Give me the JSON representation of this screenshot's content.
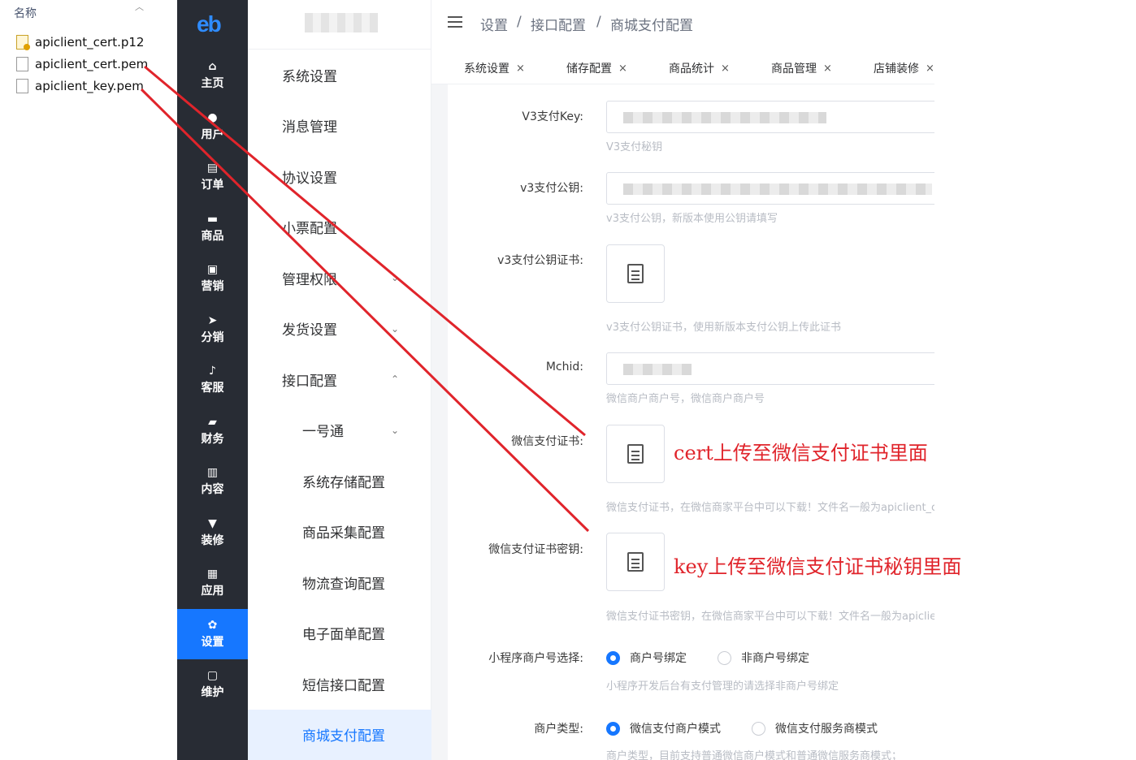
{
  "files": {
    "header": "名称",
    "items": [
      {
        "name": "apiclient_cert.p12",
        "type": "cert"
      },
      {
        "name": "apiclient_cert.pem",
        "type": "doc"
      },
      {
        "name": "apiclient_key.pem",
        "type": "doc"
      }
    ]
  },
  "nav": {
    "logo": "eb",
    "items": [
      {
        "label": "主页",
        "icon": "home-icon",
        "glyph": "⌂"
      },
      {
        "label": "用户",
        "icon": "user-icon",
        "glyph": "●"
      },
      {
        "label": "订单",
        "icon": "order-icon",
        "glyph": "▤"
      },
      {
        "label": "商品",
        "icon": "goods-icon",
        "glyph": "▬"
      },
      {
        "label": "营销",
        "icon": "chart-icon",
        "glyph": "▣"
      },
      {
        "label": "分销",
        "icon": "send-icon",
        "glyph": "➤"
      },
      {
        "label": "客服",
        "icon": "bell-icon",
        "glyph": "♪"
      },
      {
        "label": "财务",
        "icon": "wallet-icon",
        "glyph": "▰"
      },
      {
        "label": "内容",
        "icon": "book-icon",
        "glyph": "▥"
      },
      {
        "label": "装修",
        "icon": "brush-icon",
        "glyph": "▼"
      },
      {
        "label": "应用",
        "icon": "apps-icon",
        "glyph": "▦"
      },
      {
        "label": "设置",
        "icon": "gear-icon",
        "glyph": "✿",
        "active": true
      },
      {
        "label": "维护",
        "icon": "chip-icon",
        "glyph": "▢"
      }
    ]
  },
  "submenu": {
    "items": [
      {
        "label": "系统设置",
        "child": false,
        "chevron": ""
      },
      {
        "label": "消息管理",
        "child": false,
        "chevron": ""
      },
      {
        "label": "协议设置",
        "child": false,
        "chevron": ""
      },
      {
        "label": "小票配置",
        "child": false,
        "chevron": ""
      },
      {
        "label": "管理权限",
        "child": false,
        "chevron": "⌄"
      },
      {
        "label": "发货设置",
        "child": false,
        "chevron": "⌄"
      },
      {
        "label": "接口配置",
        "child": false,
        "chevron": "⌃"
      },
      {
        "label": "一号通",
        "child": true,
        "chevron": "⌄"
      },
      {
        "label": "系统存储配置",
        "child": true,
        "chevron": ""
      },
      {
        "label": "商品采集配置",
        "child": true,
        "chevron": ""
      },
      {
        "label": "物流查询配置",
        "child": true,
        "chevron": ""
      },
      {
        "label": "电子面单配置",
        "child": true,
        "chevron": ""
      },
      {
        "label": "短信接口配置",
        "child": true,
        "chevron": ""
      },
      {
        "label": "商城支付配置",
        "child": true,
        "chevron": "",
        "active": true
      }
    ]
  },
  "breadcrumb": {
    "items": [
      "设置",
      "/",
      "接口配置",
      "/",
      "商城支付配置"
    ]
  },
  "tabs": [
    {
      "label": "系统设置",
      "close": "×"
    },
    {
      "label": "储存配置",
      "close": "×"
    },
    {
      "label": "商品统计",
      "close": "×"
    },
    {
      "label": "商品管理",
      "close": "×"
    },
    {
      "label": "店铺装修",
      "close": "×"
    }
  ],
  "form": {
    "v3key": {
      "label": "V3支付Key:",
      "hint": "V3支付秘钥"
    },
    "v3pub": {
      "label": "v3支付公钥:",
      "hint": "v3支付公钥，新版本使用公钥请填写"
    },
    "v3cert": {
      "label": "v3支付公钥证书:",
      "hint": "v3支付公钥证书，使用新版本支付公钥上传此证书"
    },
    "mchid": {
      "label": "Mchid:",
      "hint": "微信商户商户号，微信商户商户号"
    },
    "wxcert": {
      "label": "微信支付证书:",
      "hint": "微信支付证书，在微信商家平台中可以下载！文件名一般为apiclient_cert.pem"
    },
    "wxkey": {
      "label": "微信支付证书密钥:",
      "hint": "微信支付证书密钥，在微信商家平台中可以下载！文件名一般为apiclient_key.pem"
    },
    "mini": {
      "label": "小程序商户号选择:",
      "opt1": "商户号绑定",
      "opt2": "非商户号绑定",
      "hint": "小程序开发后台有支付管理的请选择非商户号绑定"
    },
    "mtype": {
      "label": "商户类型:",
      "opt1": "微信支付商户模式",
      "opt2": "微信支付服务商模式",
      "hint": "商户类型，目前支持普通微信商户模式和普通微信服务商模式；"
    }
  },
  "annotations": {
    "cert": "cert上传至微信支付证书里面",
    "key": "key上传至微信支付证书秘钥里面",
    "color": "#e0242b"
  }
}
